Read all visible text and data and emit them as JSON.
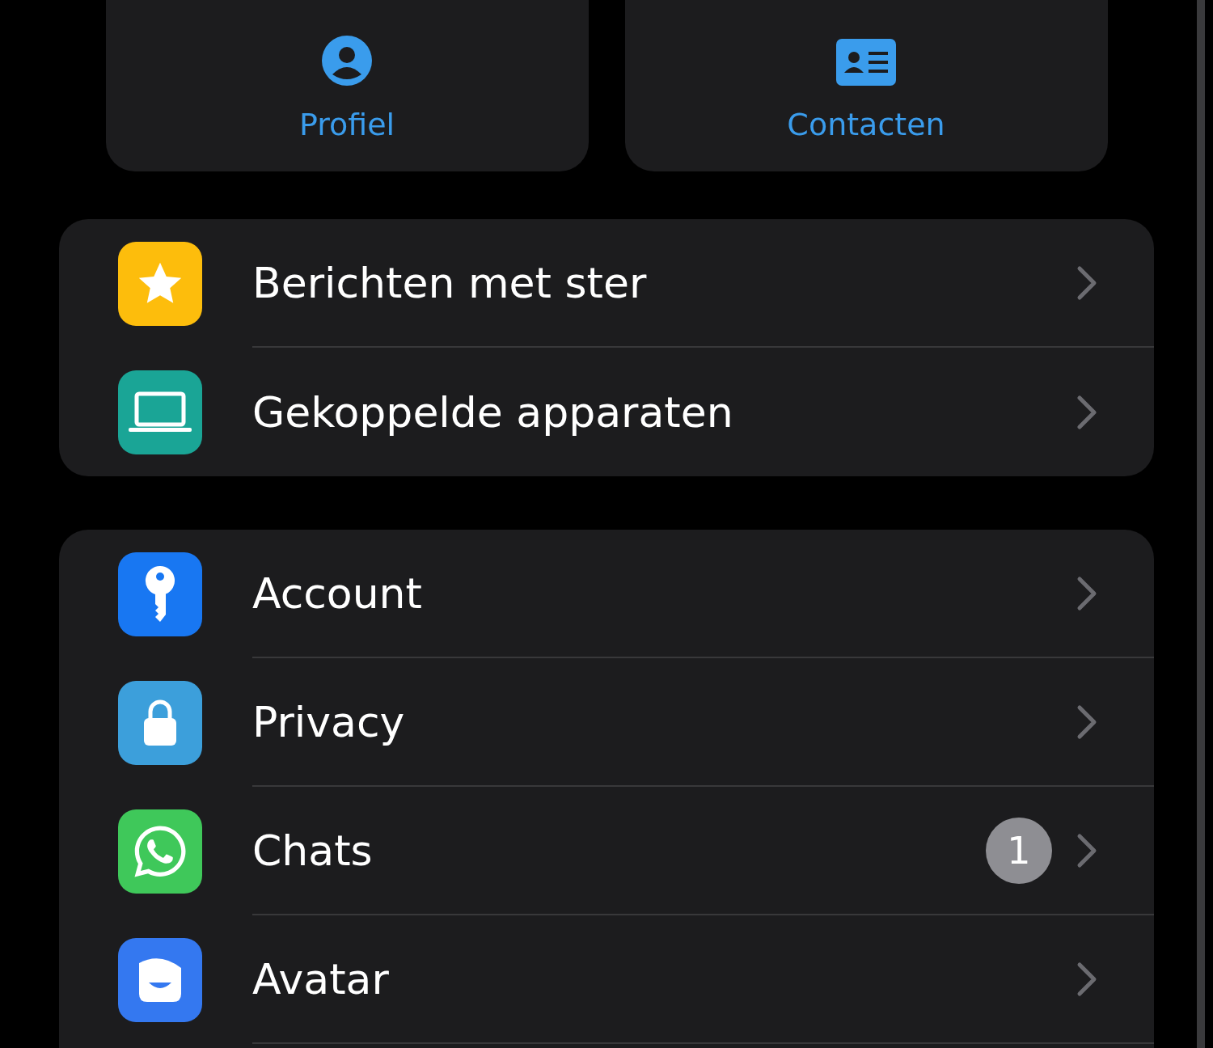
{
  "quick_actions": [
    {
      "kind": "profile",
      "label": "Profiel"
    },
    {
      "kind": "contacts",
      "label": "Contacten"
    }
  ],
  "groups": [
    {
      "items": [
        {
          "kind": "star",
          "color": "#fdbd0c",
          "label": "Berichten met ster"
        },
        {
          "kind": "laptop",
          "color": "#1aa596",
          "label": "Gekoppelde apparaten"
        }
      ]
    },
    {
      "items": [
        {
          "kind": "key",
          "color": "#1877f2",
          "label": "Account"
        },
        {
          "kind": "lock",
          "color": "#3c9fdb",
          "label": "Privacy"
        },
        {
          "kind": "chat",
          "color": "#3fc85a",
          "label": "Chats",
          "badge": "1"
        },
        {
          "kind": "avatar",
          "color": "#3478f0",
          "label": "Avatar"
        }
      ]
    }
  ]
}
